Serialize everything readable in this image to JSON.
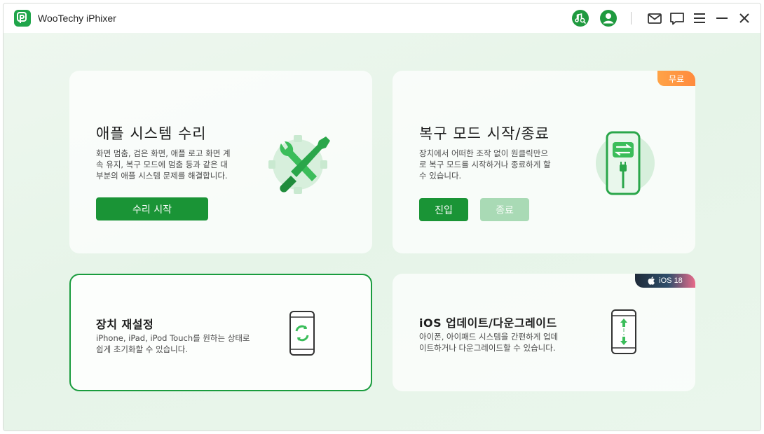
{
  "app": {
    "title": "WooTechy iPhixer"
  },
  "titlebar": {
    "icons": [
      "music-search-icon",
      "account-icon",
      "mail-icon",
      "feedback-icon",
      "menu-icon",
      "minimize-icon",
      "close-icon"
    ]
  },
  "cards": {
    "system_repair": {
      "title": "애플 시스템 수리",
      "desc_lines": [
        "화면 멈춤, 검은 화면, 애플 로고 화면 계",
        "속 유지, 복구 모드에 멈춤 등과 같은 대",
        "부분의 애플 시스템 문제를 해결합니다."
      ],
      "button": "수리 시작",
      "icon": "wrench-screwdriver-icon"
    },
    "recovery_mode": {
      "title": "복구 모드 시작/종료",
      "desc_lines": [
        "장치에서 어떠한 조작 없이 원클릭만으",
        "로 복구 모드를 시작하거나 종료하게 할",
        "수 있습니다."
      ],
      "badge": "무료",
      "enter_button": "진입",
      "exit_button": "종료",
      "icon": "phone-switch-icon"
    },
    "device_reset": {
      "title": "장치 재설정",
      "desc_lines": [
        "iPhone, iPad, iPod Touch를 원하는 상태로",
        "쉽게 초기화할 수 있습니다."
      ],
      "icon": "phone-refresh-icon"
    },
    "ios_update": {
      "title": "iOS 업데이트/다운그레이드",
      "desc_lines": [
        "아이폰, 아이패드 시스템을 간편하게 업데",
        "이트하거나 다운그레이드할 수 있습니다."
      ],
      "badge": "iOS 18",
      "icon": "phone-up-down-icon"
    }
  },
  "colors": {
    "accent": "#1a9436",
    "accent_light": "#a9dab5",
    "badge_orange": "#ff8a3d"
  }
}
